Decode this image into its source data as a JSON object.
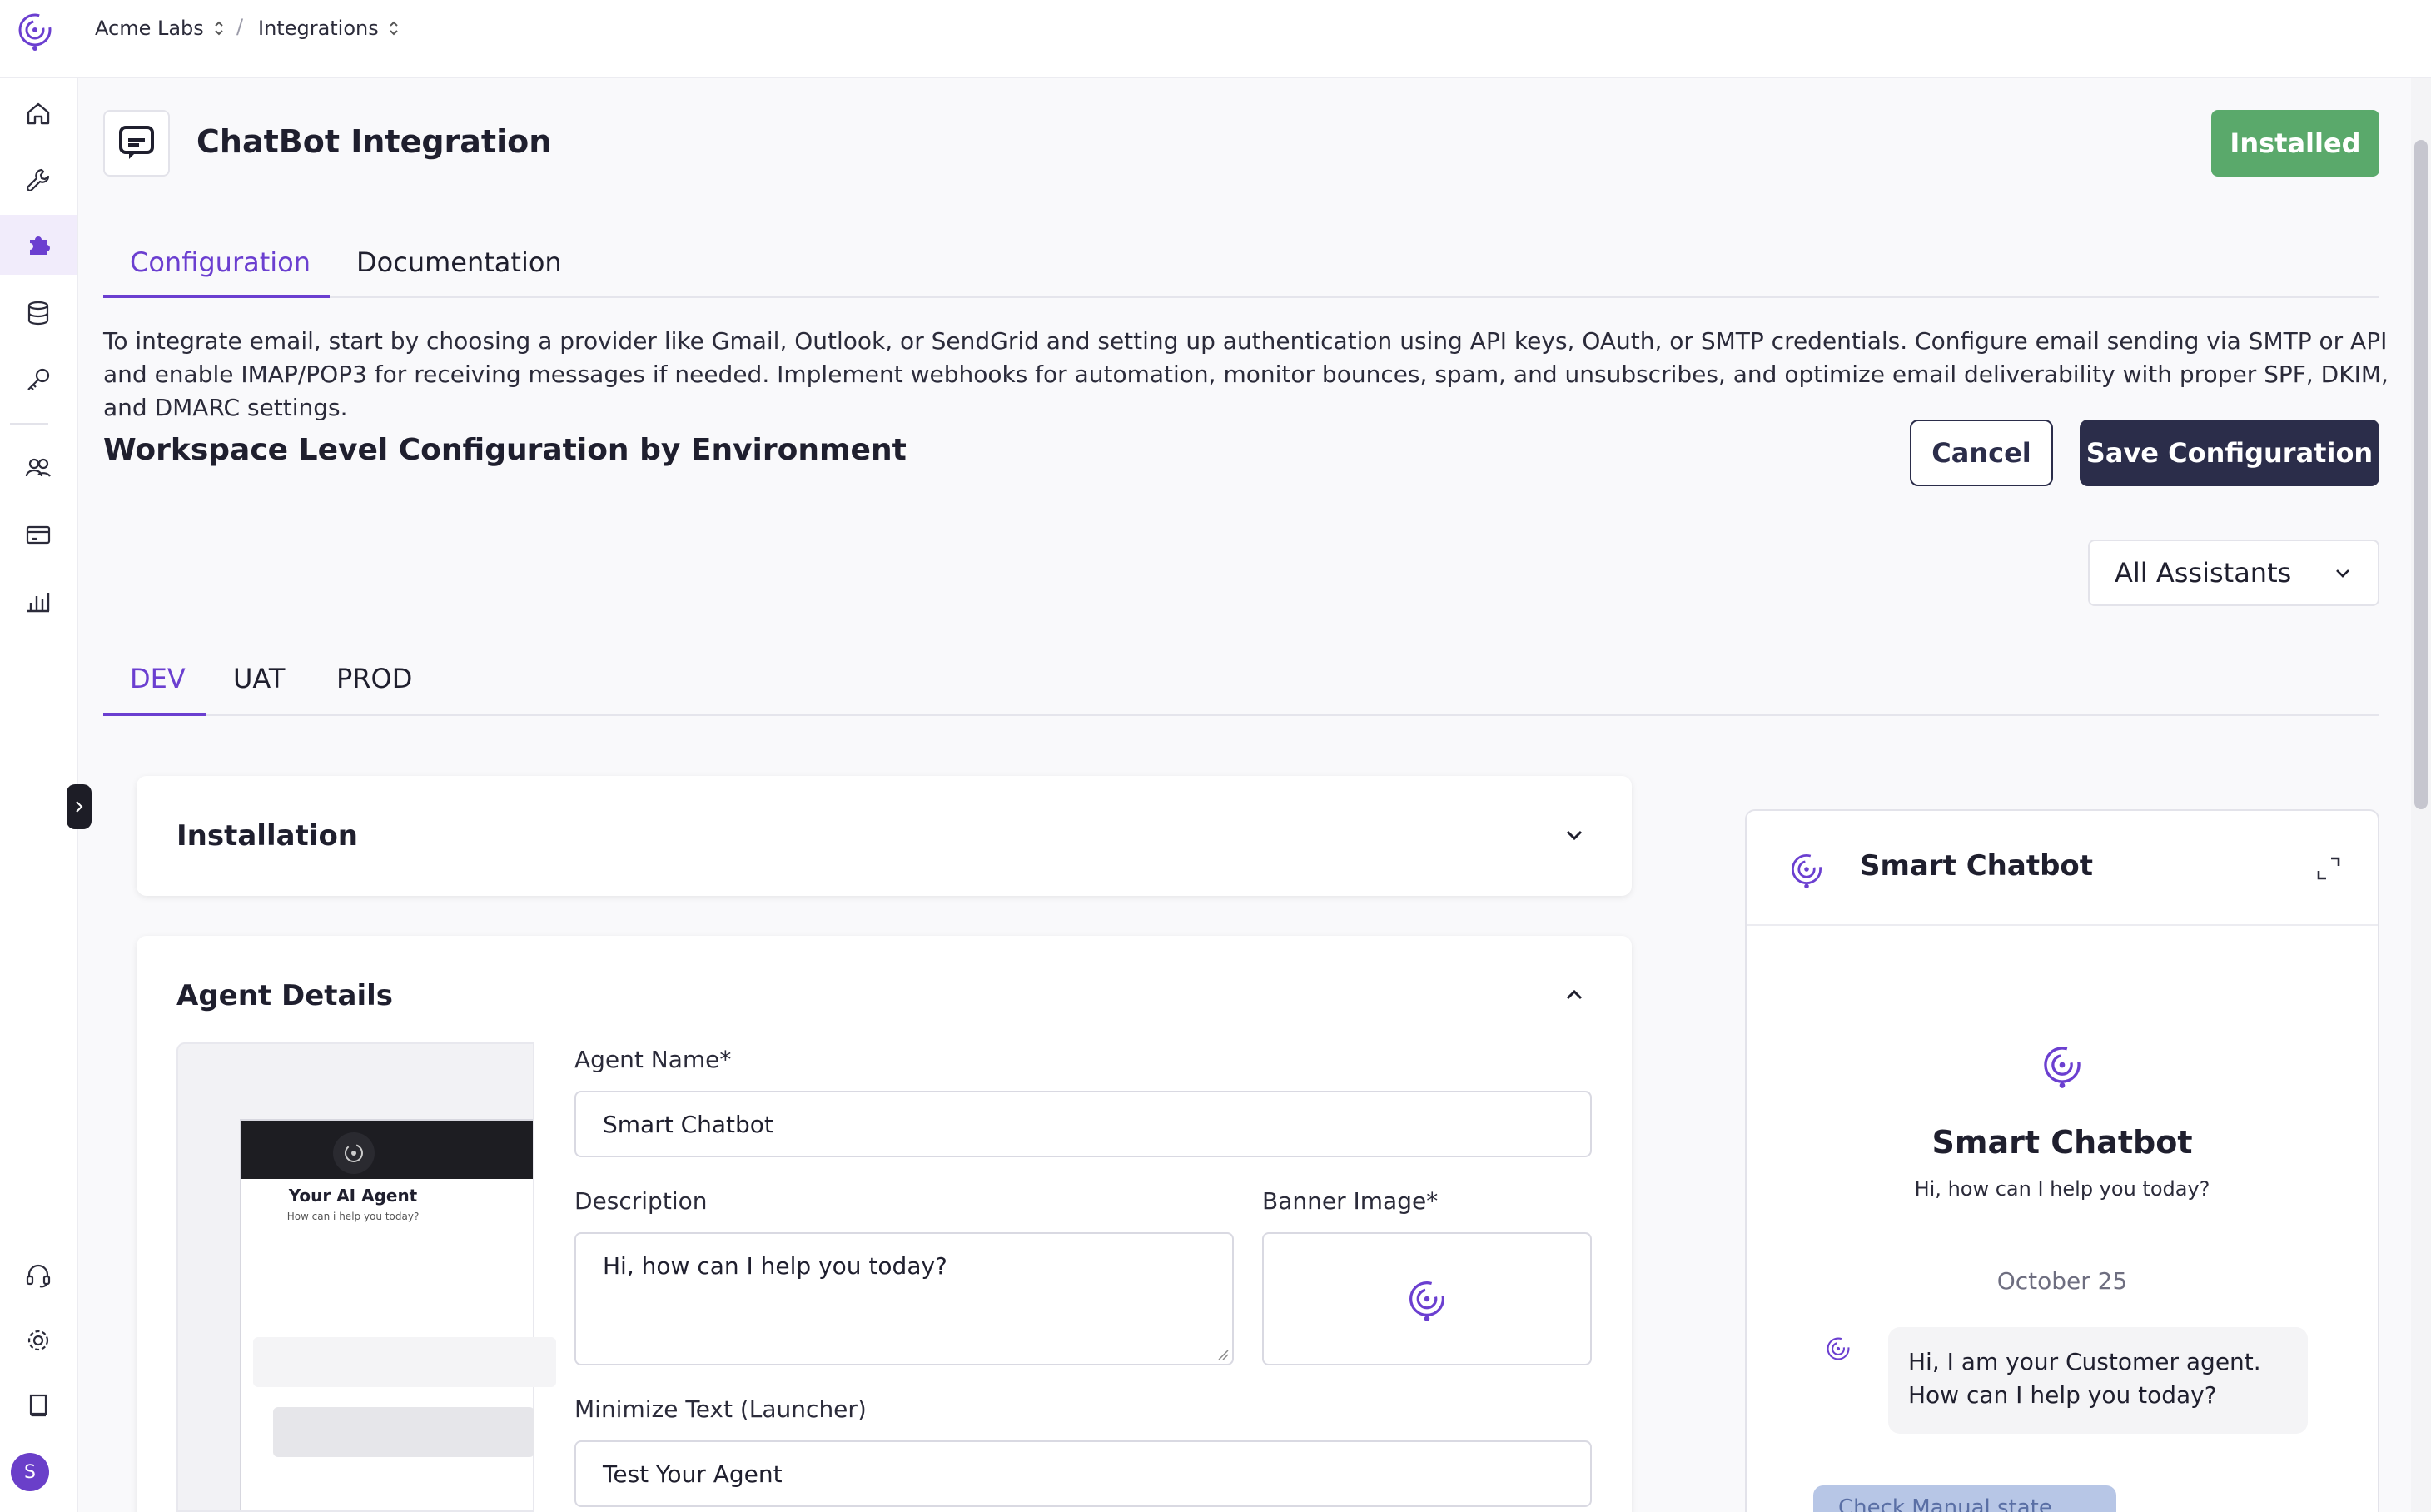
{
  "breadcrumb": {
    "workspace": "Acme Labs",
    "separator": "/",
    "section": "Integrations"
  },
  "sidebar": {
    "items": [
      {
        "name": "home-icon"
      },
      {
        "name": "wrench-icon"
      },
      {
        "name": "puzzle-icon",
        "active": true
      },
      {
        "name": "database-icon"
      },
      {
        "name": "key-icon"
      },
      {
        "name": "users-icon"
      },
      {
        "name": "billing-icon"
      },
      {
        "name": "analytics-icon"
      }
    ],
    "bottom_items": [
      {
        "name": "support-icon"
      },
      {
        "name": "settings-icon"
      },
      {
        "name": "docs-icon"
      }
    ],
    "avatar_initial": "S"
  },
  "integration": {
    "title": "ChatBot Integration",
    "status": "Installed",
    "status_color": "#5aa96b"
  },
  "tabs": {
    "configuration": "Configuration",
    "documentation": "Documentation"
  },
  "description": "To integrate email, start by choosing a provider like Gmail, Outlook, or SendGrid and setting up authentication using API keys, OAuth, or SMTP credentials. Configure email sending via SMTP or API and enable IMAP/POP3 for receiving messages if needed. Implement webhooks for automation, monitor bounces, spam, and unsubscribes, and optimize email deliverability with proper SPF, DKIM, and DMARC settings.",
  "config": {
    "title": "Workspace Level Configuration by Environment",
    "cancel_label": "Cancel",
    "save_label": "Save Configuration",
    "assistant_filter": "All Assistants"
  },
  "env_tabs": {
    "dev": "DEV",
    "uat": "UAT",
    "prod": "PROD"
  },
  "installation": {
    "title": "Installation"
  },
  "agent_details": {
    "title": "Agent Details",
    "preview": {
      "name": "Your AI Agent",
      "subtitle": "How can i help you today?"
    },
    "agent_name_label": "Agent Name*",
    "agent_name_value": "Smart Chatbot",
    "description_label": "Description",
    "description_value": "Hi, how can I help you today?",
    "banner_label": "Banner Image*",
    "minimize_label": "Minimize Text (Launcher)",
    "minimize_value": "Test Your Agent"
  },
  "chat_preview": {
    "header_title": "Smart Chatbot",
    "center_name": "Smart Chatbot",
    "center_subtitle": "Hi, how can I help you today?",
    "date": "October 25",
    "bot_message": "Hi, I am your Customer agent. How can I help you today?",
    "quick_reply": "Check Manual state"
  },
  "colors": {
    "accent": "#6b3fd0",
    "primary_button": "#2b2d4a"
  }
}
